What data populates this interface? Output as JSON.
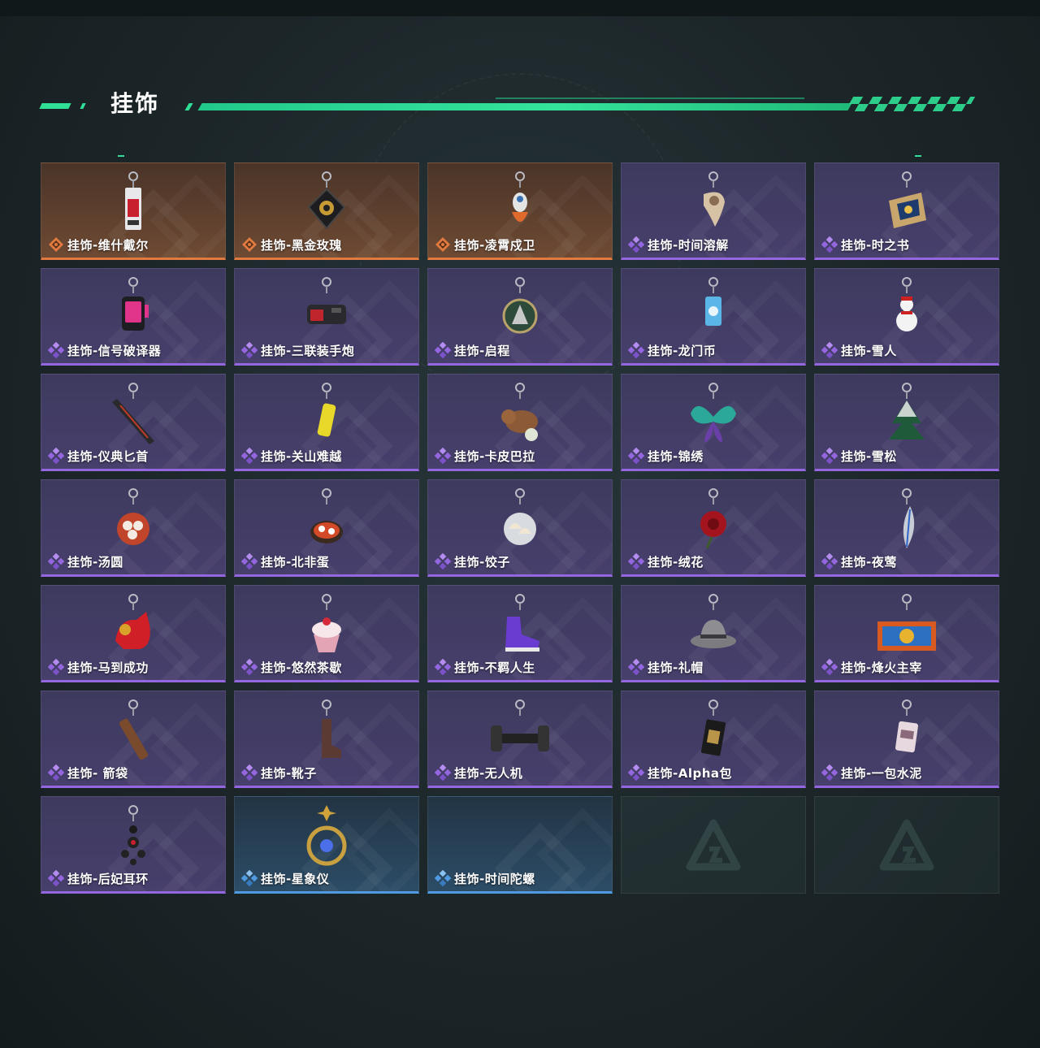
{
  "header": {
    "title": "挂饰"
  },
  "colors": {
    "accent": "#2fdf96",
    "rarity_orange": "#e07a3e",
    "rarity_purple": "#9466e0",
    "rarity_blue": "#4f9ae0"
  },
  "items": [
    {
      "name": "挂饰-维什戴尔",
      "rarity": "orange",
      "icon": "keycard-charm-icon"
    },
    {
      "name": "挂饰-黑金玫瑰",
      "rarity": "orange",
      "icon": "black-rose-charm-icon"
    },
    {
      "name": "挂饰-凌霄戍卫",
      "rarity": "orange",
      "icon": "guardian-figure-charm-icon"
    },
    {
      "name": "挂饰-时间溶解",
      "rarity": "purple",
      "icon": "melting-clock-charm-icon"
    },
    {
      "name": "挂饰-时之书",
      "rarity": "purple",
      "icon": "book-charm-icon"
    },
    {
      "name": "挂饰-信号破译器",
      "rarity": "purple",
      "icon": "signal-device-charm-icon"
    },
    {
      "name": "挂饰-三联装手炮",
      "rarity": "purple",
      "icon": "hand-cannon-charm-icon"
    },
    {
      "name": "挂饰-启程",
      "rarity": "purple",
      "icon": "medallion-charm-icon"
    },
    {
      "name": "挂饰-龙门币",
      "rarity": "purple",
      "icon": "coin-card-charm-icon"
    },
    {
      "name": "挂饰-雪人",
      "rarity": "purple",
      "icon": "snowman-charm-icon"
    },
    {
      "name": "挂饰-仪典匕首",
      "rarity": "purple",
      "icon": "dagger-charm-icon"
    },
    {
      "name": "挂饰-关山难越",
      "rarity": "purple",
      "icon": "yellow-can-charm-icon"
    },
    {
      "name": "挂饰-卡皮巴拉",
      "rarity": "purple",
      "icon": "capybara-charm-icon"
    },
    {
      "name": "挂饰-锦绣",
      "rarity": "purple",
      "icon": "butterfly-charm-icon"
    },
    {
      "name": "挂饰-雪松",
      "rarity": "purple",
      "icon": "pine-tree-charm-icon"
    },
    {
      "name": "挂饰-汤圆",
      "rarity": "purple",
      "icon": "dumpling-bowl-charm-icon"
    },
    {
      "name": "挂饰-北非蛋",
      "rarity": "purple",
      "icon": "shakshuka-pan-charm-icon"
    },
    {
      "name": "挂饰-饺子",
      "rarity": "purple",
      "icon": "dumplings-plate-charm-icon"
    },
    {
      "name": "挂饰-绒花",
      "rarity": "purple",
      "icon": "red-flower-charm-icon"
    },
    {
      "name": "挂饰-夜莺",
      "rarity": "purple",
      "icon": "feather-charm-icon"
    },
    {
      "name": "挂饰-马到成功",
      "rarity": "purple",
      "icon": "red-horse-charm-icon"
    },
    {
      "name": "挂饰-悠然茶歇",
      "rarity": "purple",
      "icon": "cupcake-charm-icon"
    },
    {
      "name": "挂饰-不羁人生",
      "rarity": "purple",
      "icon": "sneaker-charm-icon"
    },
    {
      "name": "挂饰-礼帽",
      "rarity": "purple",
      "icon": "fedora-hat-charm-icon"
    },
    {
      "name": "挂饰-烽火主宰",
      "rarity": "purple",
      "icon": "container-charm-icon"
    },
    {
      "name": "挂饰- 箭袋",
      "rarity": "purple",
      "icon": "quiver-charm-icon"
    },
    {
      "name": "挂饰-靴子",
      "rarity": "purple",
      "icon": "boot-charm-icon"
    },
    {
      "name": "挂饰-无人机",
      "rarity": "purple",
      "icon": "drone-charm-icon"
    },
    {
      "name": "挂饰-Alpha包",
      "rarity": "purple",
      "icon": "alpha-pack-charm-icon"
    },
    {
      "name": "挂饰-一包水泥",
      "rarity": "purple",
      "icon": "cement-bag-charm-icon"
    },
    {
      "name": "挂饰-后妃耳环",
      "rarity": "purple",
      "icon": "earring-charm-icon"
    },
    {
      "name": "挂饰-星象仪",
      "rarity": "blue",
      "icon": "astrolabe-charm-icon"
    },
    {
      "name": "挂饰-时间陀螺",
      "rarity": "blue",
      "icon": ""
    },
    {
      "name": "",
      "rarity": "empty",
      "icon": "empty-slot-logo-icon"
    },
    {
      "name": "",
      "rarity": "empty",
      "icon": "empty-slot-logo-icon"
    }
  ]
}
